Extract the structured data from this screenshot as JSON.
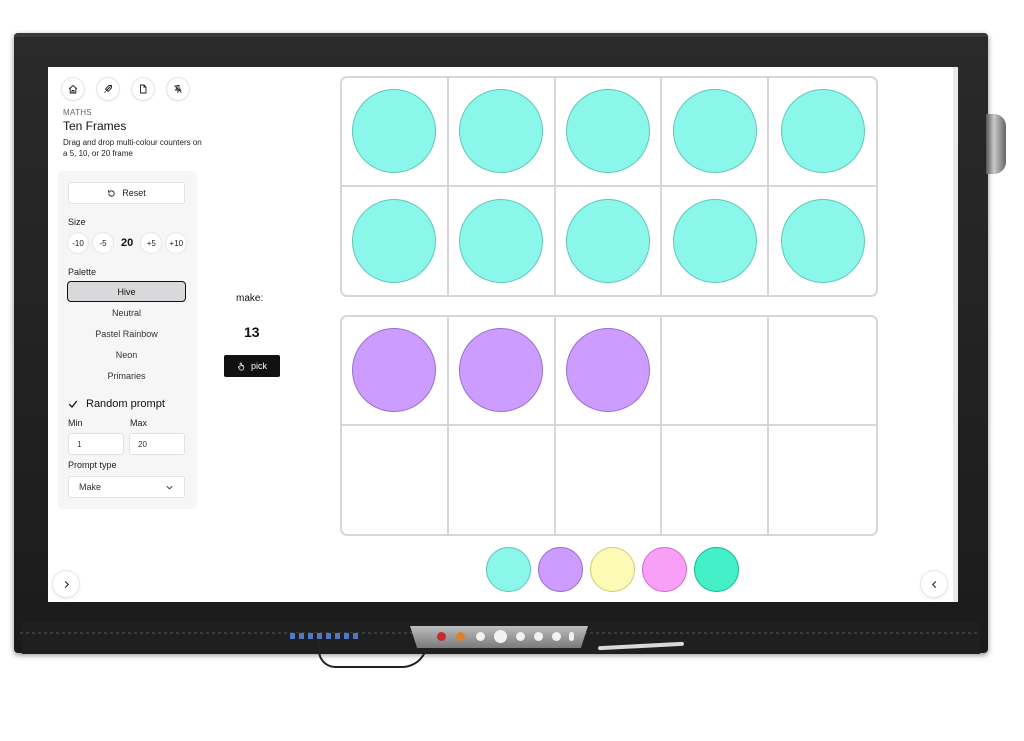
{
  "app": {
    "subject": "MATHS",
    "title": "Ten Frames",
    "description": "Drag and drop multi-colour counters on a 5, 10, or 20 frame"
  },
  "toolbar": {
    "icons": [
      "home-icon",
      "rocket-icon",
      "document-icon",
      "pin-off-icon"
    ]
  },
  "panel": {
    "reset_label": "Reset",
    "size_label": "Size",
    "size_buttons": [
      "-10",
      "-5",
      "+5",
      "+10"
    ],
    "size_value": "20",
    "palette_label": "Palette",
    "palettes": [
      "Hive",
      "Neutral",
      "Pastel Rainbow",
      "Neon",
      "Primaries"
    ],
    "selected_palette": "Hive",
    "random_prompt_label": "Random prompt",
    "random_prompt_checked": true,
    "min_label": "Min",
    "min_value": "1",
    "max_label": "Max",
    "max_value": "20",
    "prompt_type_label": "Prompt type",
    "prompt_type_value": "Make"
  },
  "prompt": {
    "label": "make:",
    "number": "13",
    "pick_label": "pick"
  },
  "frames": [
    {
      "cells": [
        "#8af7ea",
        "#8af7ea",
        "#8af7ea",
        "#8af7ea",
        "#8af7ea",
        "#8af7ea",
        "#8af7ea",
        "#8af7ea",
        "#8af7ea",
        "#8af7ea"
      ]
    },
    {
      "cells": [
        "#cc9cff",
        "#cc9cff",
        "#cc9cff",
        null,
        null,
        null,
        null,
        null,
        null,
        null
      ]
    }
  ],
  "counter_borders": {
    "#8af7ea": "#5fc7b8",
    "#cc9cff": "#9a6fd0"
  },
  "swatches": [
    {
      "fill": "#8af7ea",
      "border": "#5fc7b8"
    },
    {
      "fill": "#cc9cff",
      "border": "#9a6fd0"
    },
    {
      "fill": "#fbfbb6",
      "border": "#cfcf7e"
    },
    {
      "fill": "#fa9ff7",
      "border": "#cc72c9"
    },
    {
      "fill": "#43f0c8",
      "border": "#1fb893"
    }
  ],
  "nav": {
    "next_icon": "chevron-right-icon",
    "prev_icon": "chevron-left-icon"
  }
}
